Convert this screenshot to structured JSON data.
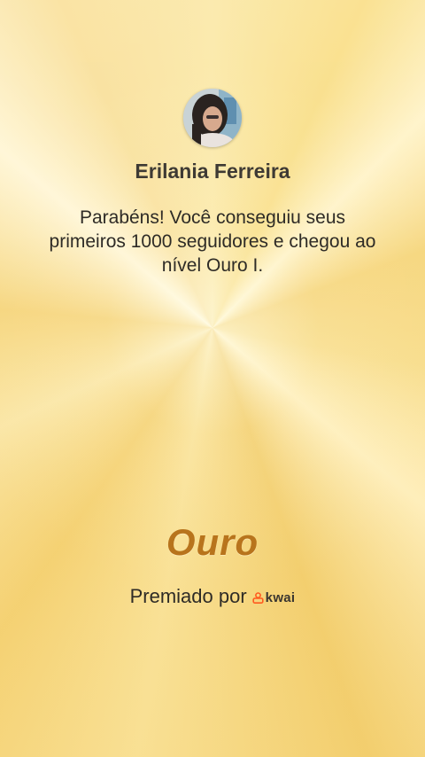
{
  "profile": {
    "name": "Erilania Ferreira"
  },
  "message": "Parabéns! Você conseguiu seus primeiros 1000 seguidores e chegou ao nível Ouro I.",
  "level": {
    "title": "Ouro"
  },
  "footer": {
    "awarded_by": "Premiado por",
    "brand": "kwai",
    "brand_icon": "kwai-logo-icon",
    "brand_color": "#ff5a1f"
  }
}
